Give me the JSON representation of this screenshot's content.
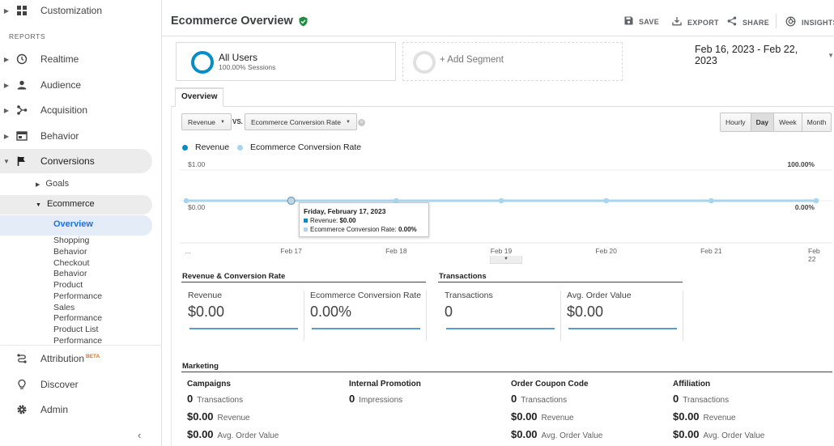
{
  "sidebar": {
    "customization": "Customization",
    "reports_heading": "REPORTS",
    "items": [
      {
        "label": "Realtime",
        "icon": "clock-icon"
      },
      {
        "label": "Audience",
        "icon": "person-icon"
      },
      {
        "label": "Acquisition",
        "icon": "acquisition-icon"
      },
      {
        "label": "Behavior",
        "icon": "behavior-icon"
      },
      {
        "label": "Conversions",
        "icon": "flag-icon"
      }
    ],
    "goals": "Goals",
    "ecommerce": "Ecommerce",
    "ecommerce_items": [
      "Overview",
      "Shopping Behavior",
      "Checkout Behavior",
      "Product Performance",
      "Sales Performance",
      "Product List Performance"
    ],
    "shopping_behavior": [
      "Shopping",
      "Behavior"
    ],
    "checkout_behavior": [
      "Checkout",
      "Behavior"
    ],
    "product_performance": [
      "Product",
      "Performance"
    ],
    "sales_performance": [
      "Sales",
      "Performance"
    ],
    "product_list_performance": [
      "Product List",
      "Performance"
    ],
    "attribution": "Attribution",
    "attribution_badge": "BETA",
    "discover": "Discover",
    "admin": "Admin"
  },
  "header": {
    "title": "Ecommerce Overview",
    "save": "SAVE",
    "export": "EXPORT",
    "share": "SHARE",
    "insights": "INSIGHTS"
  },
  "segments": {
    "active_title": "All Users",
    "active_sub": "100.00% Sessions",
    "add": "+ Add Segment"
  },
  "date_range": "Feb 16, 2023 - Feb 22, 2023",
  "tabs": [
    "Overview"
  ],
  "chart_controls": {
    "metric1": "Revenue",
    "vs": "VS.",
    "metric2": "Ecommerce Conversion Rate",
    "granularity": [
      "Hourly",
      "Day",
      "Week",
      "Month"
    ],
    "granularity_selected": "Day"
  },
  "colors": {
    "revenue": "#058dc7",
    "conversion": "#a7d5ee",
    "accent": "#1e8e3e"
  },
  "chart_data": {
    "type": "line",
    "x": [
      "Feb 16",
      "Feb 17",
      "Feb 18",
      "Feb 19",
      "Feb 20",
      "Feb 21",
      "Feb 22"
    ],
    "x_tick_labels": [
      "...",
      "Feb 17",
      "Feb 18",
      "Feb 19",
      "Feb 20",
      "Feb 21",
      "Feb 22"
    ],
    "series": [
      {
        "name": "Revenue",
        "values": [
          0,
          0,
          0,
          0,
          0,
          0,
          0
        ],
        "axis": "left"
      },
      {
        "name": "Ecommerce Conversion Rate",
        "values": [
          0,
          0,
          0,
          0,
          0,
          0,
          0
        ],
        "axis": "right"
      }
    ],
    "left_ticks": [
      "$1.00",
      "$0.00"
    ],
    "right_ticks": [
      "100.00%",
      "0.00%"
    ],
    "ylim_left": [
      0,
      1
    ],
    "ylim_right": [
      0,
      100
    ],
    "legend_placement": "top-left",
    "grid": true,
    "tooltip": {
      "title": "Friday, February 17, 2023",
      "rows": [
        {
          "label": "Revenue:",
          "value": "$0.00"
        },
        {
          "label": "Ecommerce Conversion Rate:",
          "value": "0.00%"
        }
      ],
      "highlight_index": 1
    }
  },
  "summary": {
    "section1_title": "Revenue & Conversion Rate",
    "section2_title": "Transactions",
    "metrics": [
      {
        "name": "Revenue",
        "value": "$0.00"
      },
      {
        "name": "Ecommerce Conversion Rate",
        "value": "0.00%"
      },
      {
        "name": "Transactions",
        "value": "0"
      },
      {
        "name": "Avg. Order Value",
        "value": "$0.00"
      }
    ]
  },
  "marketing": {
    "title": "Marketing",
    "columns": [
      {
        "heading": "Campaigns",
        "rows": [
          {
            "value": "0",
            "label": "Transactions"
          },
          {
            "value": "$0.00",
            "label": "Revenue"
          },
          {
            "value": "$0.00",
            "label": "Avg. Order Value"
          }
        ]
      },
      {
        "heading": "Internal Promotion",
        "rows": [
          {
            "value": "0",
            "label": "Impressions"
          }
        ]
      },
      {
        "heading": "Order Coupon Code",
        "rows": [
          {
            "value": "0",
            "label": "Transactions"
          },
          {
            "value": "$0.00",
            "label": "Revenue"
          },
          {
            "value": "$0.00",
            "label": "Avg. Order Value"
          }
        ]
      },
      {
        "heading": "Affiliation",
        "rows": [
          {
            "value": "0",
            "label": "Transactions"
          },
          {
            "value": "$0.00",
            "label": "Revenue"
          },
          {
            "value": "$0.00",
            "label": "Avg. Order Value"
          }
        ]
      }
    ]
  }
}
